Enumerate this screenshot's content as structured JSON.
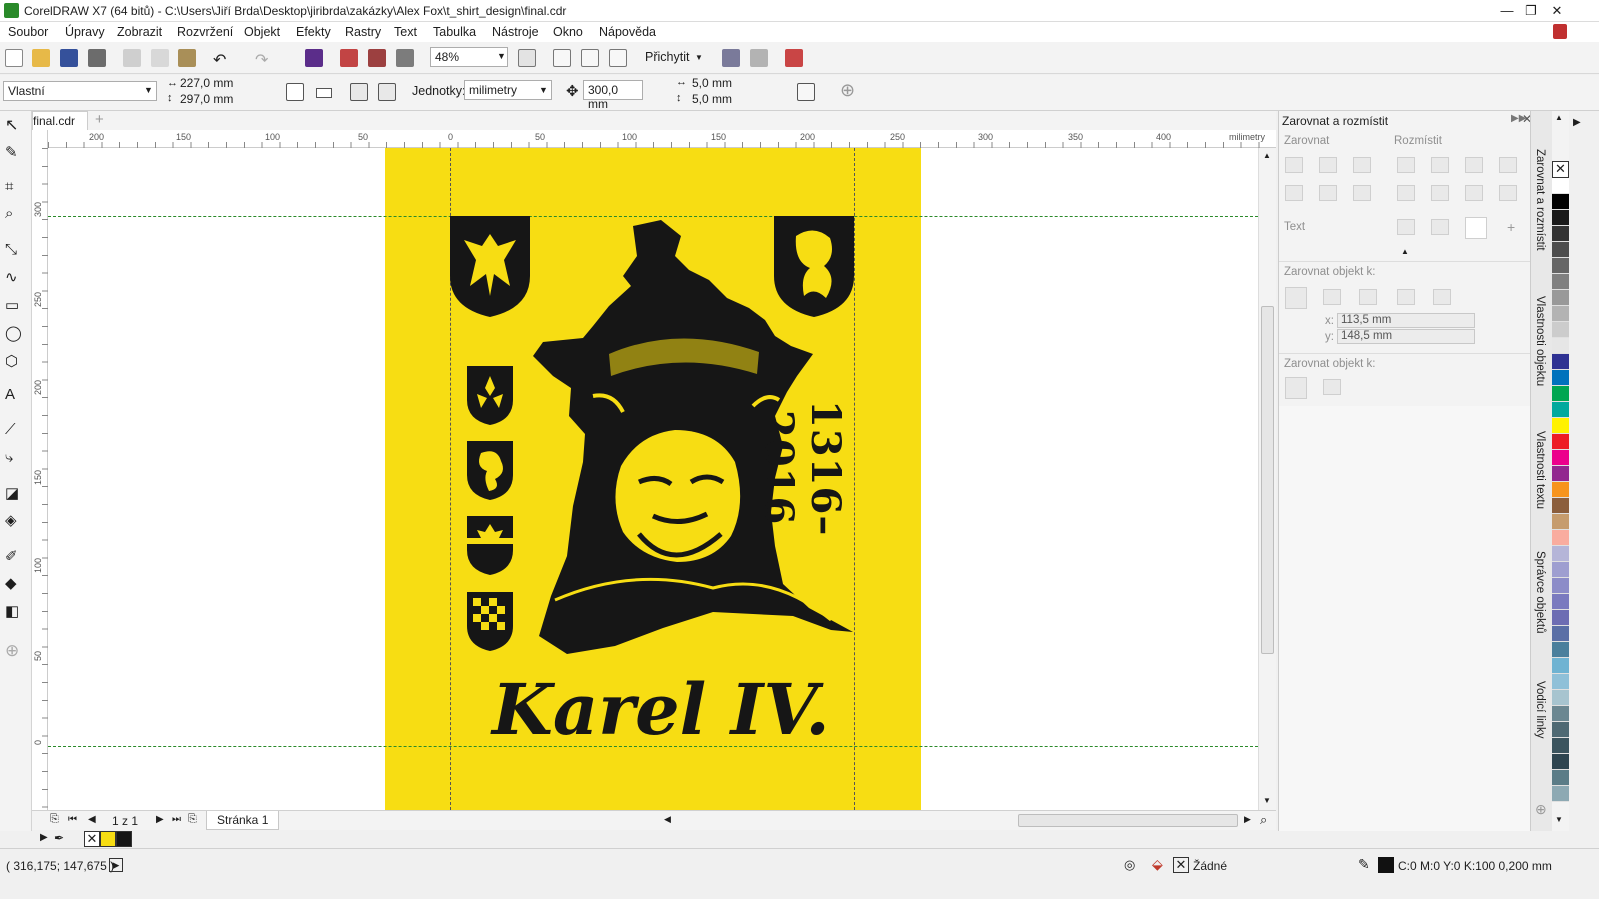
{
  "window": {
    "title": "CorelDRAW X7 (64 bitů) - C:\\Users\\Jiří Brda\\Desktop\\jiribrda\\zakázky\\Alex Fox\\t_shirt_design\\final.cdr",
    "minimize": "—",
    "restore": "❐",
    "close": "✕"
  },
  "menu": [
    "Soubor",
    "Úpravy",
    "Zobrazit",
    "Rozvržení",
    "Objekt",
    "Efekty",
    "Rastry",
    "Text",
    "Tabulka",
    "Nástroje",
    "Okno",
    "Nápověda"
  ],
  "toolbar": {
    "zoom": "48%",
    "snap_label": "Přichytit"
  },
  "propbar": {
    "page_preset": "Vlastní",
    "width": "227,0 mm",
    "height": "297,0 mm",
    "units_label": "Jednotky:",
    "units_value": "milimetry",
    "nudge": "300,0 mm",
    "dup_x": "5,0 mm",
    "dup_y": "5,0 mm"
  },
  "document": {
    "tab_name": "final.cdr",
    "ruler_unit": "milimetry",
    "h_ticks": [
      "200",
      "150",
      "100",
      "50",
      "0",
      "50",
      "100",
      "150",
      "200",
      "250",
      "300",
      "350",
      "400"
    ],
    "v_ticks": [
      "300",
      "250",
      "200",
      "150",
      "100",
      "50",
      "0"
    ],
    "page_indicator": "1 z 1",
    "page_tab": "Stránka 1"
  },
  "artwork": {
    "background_color": "#f7dd13",
    "ink_color": "#161616",
    "name_text": "Karel IV.",
    "years_text": "1316–2016"
  },
  "docker": {
    "title": "Zarovnat a rozmístit",
    "align_label": "Zarovnat",
    "distribute_label": "Rozmístit",
    "text_label": "Text",
    "align_to_label": "Zarovnat objekt k:",
    "x_label": "x:",
    "x_value": "113,5 mm",
    "y_label": "y:",
    "y_value": "148,5 mm",
    "distribute_to_label": "Zarovnat objekt k:"
  },
  "docker_tabs": [
    "Zarovnat a rozmístit",
    "Vlastnosti objektu",
    "Vlastnosti textu",
    "Správce objektů",
    "Vodicí linky"
  ],
  "palette_colors": [
    "#ffffff",
    "#000000",
    "#1a1a1a",
    "#333333",
    "#4d4d4d",
    "#666666",
    "#808080",
    "#999999",
    "#b3b3b3",
    "#cccccc",
    "#e6e6e6",
    "#2e3192",
    "#0072bc",
    "#00a651",
    "#00a99d",
    "#fff200",
    "#ed1c24",
    "#ec008c",
    "#92278f",
    "#f7941d",
    "#8b5e3c",
    "#c69c6d",
    "#f9ac9f",
    "#b5b5d8",
    "#9e9ed0",
    "#8c8cc8",
    "#7a7abf",
    "#6d6db3",
    "#5a6fa6",
    "#4a7f9c",
    "#6fb3d2",
    "#8fc0d8",
    "#a7c4cf",
    "#6b8791",
    "#4e6973",
    "#3b545e",
    "#2e4550",
    "#5b7c87",
    "#8da9b3"
  ],
  "status": {
    "coords": "( 316,175; 147,675 )",
    "fill_label": "Žádné",
    "outline_label": "C:0 M:0 Y:0 K:100  0,200 mm"
  }
}
